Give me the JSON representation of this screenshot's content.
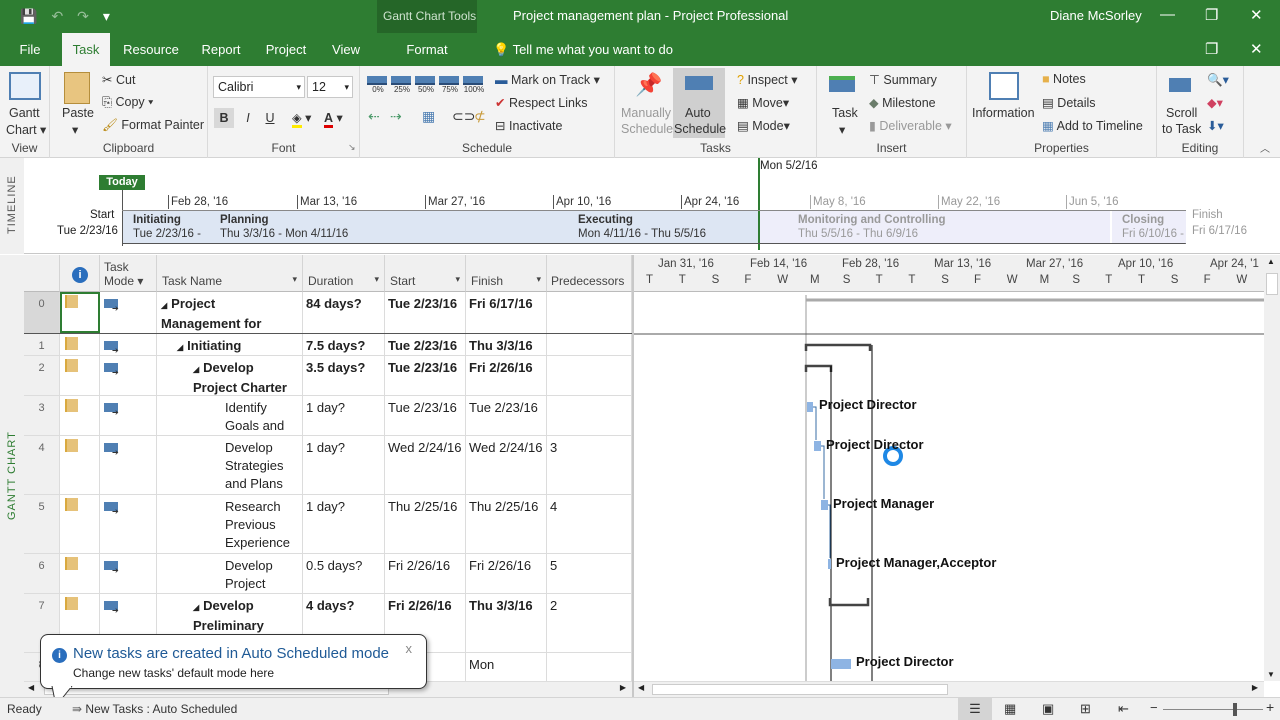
{
  "titlebar": {
    "context_tool": "Gantt Chart Tools",
    "title": "Project management plan - Project Professional",
    "user": "Diane McSorley",
    "icons": [
      "save-icon",
      "undo-icon",
      "redo-icon",
      "customize-qat-icon"
    ],
    "window_controls": [
      "minimize",
      "restore",
      "close"
    ]
  },
  "tabs": [
    {
      "label": "File"
    },
    {
      "label": "Task",
      "active": true
    },
    {
      "label": "Resource"
    },
    {
      "label": "Report"
    },
    {
      "label": "Project"
    },
    {
      "label": "View"
    },
    {
      "label": "Format"
    }
  ],
  "tell_me": "Tell me what you want to do",
  "ribbon": {
    "view": {
      "group": "View",
      "gantt_chart": "Gantt",
      "gantt_chart2": "Chart ▾"
    },
    "clipboard": {
      "group": "Clipboard",
      "paste": "Paste",
      "cut": "Cut",
      "copy": "Copy",
      "format_painter": "Format Painter"
    },
    "font": {
      "group": "Font",
      "family": "Calibri",
      "size": "12",
      "bold": "B",
      "italic": "I",
      "underline": "U"
    },
    "schedule": {
      "group": "Schedule",
      "percents": [
        "0%",
        "25%",
        "50%",
        "75%",
        "100%"
      ],
      "mark_on_track": "Mark on Track",
      "respect_links": "Respect Links",
      "inactivate": "Inactivate"
    },
    "tasks": {
      "group": "Tasks",
      "manually1": "Manually",
      "manually2": "Schedule",
      "auto1": "Auto",
      "auto2": "Schedule",
      "inspect": "Inspect",
      "move": "Move",
      "mode": "Mode"
    },
    "insert": {
      "group": "Insert",
      "task": "Task",
      "summary": "Summary",
      "milestone": "Milestone",
      "deliverable": "Deliverable"
    },
    "properties": {
      "group": "Properties",
      "information": "Information",
      "notes": "Notes",
      "details": "Details",
      "add_to_timeline": "Add to Timeline"
    },
    "editing": {
      "group": "Editing",
      "scroll1": "Scroll",
      "scroll2": "to Task"
    }
  },
  "timeline": {
    "label": "TIMELINE",
    "today": "Today",
    "current_date": "Mon 5/2/16",
    "start_label": "Start",
    "start_date": "Tue 2/23/16",
    "finish_label": "Finish",
    "finish_date": "Fri 6/17/16",
    "ticks": [
      "Feb 28, '16",
      "Mar 13, '16",
      "Mar 27, '16",
      "Apr 10, '16",
      "Apr 24, '16",
      "May 8, '16",
      "May 22, '16",
      "Jun 5, '16"
    ],
    "phases": [
      {
        "name": "Initiating",
        "dates": "Tue 2/23/16 -"
      },
      {
        "name": "Planning",
        "dates": "Thu 3/3/16 - Mon 4/11/16"
      },
      {
        "name": "Executing",
        "dates": "Mon 4/11/16 - Thu 5/5/16"
      },
      {
        "name": "Monitoring and Controlling",
        "dates": "Thu 5/5/16 - Thu 6/9/16"
      },
      {
        "name": "Closing",
        "dates": "Fri 6/10/16 -"
      }
    ]
  },
  "sheet": {
    "side_label": "GANTT CHART",
    "columns": [
      "Task Mode ▾",
      "Task Name",
      "Duration",
      "Start",
      "Finish",
      "Predecessors"
    ],
    "rows": [
      {
        "id": "0",
        "name": "Project Management for",
        "duration": "84 days?",
        "start": "Tue 2/23/16",
        "finish": "Fri 6/17/16",
        "pred": "",
        "bold": true
      },
      {
        "id": "1",
        "name": "Initiating",
        "duration": "7.5 days?",
        "start": "Tue 2/23/16",
        "finish": "Thu 3/3/16",
        "pred": "",
        "bold": true
      },
      {
        "id": "2",
        "name": "Develop Project Charter",
        "duration": "3.5 days?",
        "start": "Tue 2/23/16",
        "finish": "Fri 2/26/16",
        "pred": "",
        "bold": true
      },
      {
        "id": "3",
        "name": "Identify Goals and",
        "duration": "1 day?",
        "start": "Tue 2/23/16",
        "finish": "Tue 2/23/16",
        "pred": ""
      },
      {
        "id": "4",
        "name": "Develop Strategies and Plans",
        "duration": "1 day?",
        "start": "Wed 2/24/16",
        "finish": "Wed 2/24/16",
        "pred": "3"
      },
      {
        "id": "5",
        "name": "Research Previous Experience",
        "duration": "1 day?",
        "start": "Thu 2/25/16",
        "finish": "Thu 2/25/16",
        "pred": "4"
      },
      {
        "id": "6",
        "name": "Develop Project",
        "duration": "0.5 days?",
        "start": "Fri 2/26/16",
        "finish": "Fri 2/26/16",
        "pred": "5"
      },
      {
        "id": "7",
        "name": "Develop Preliminary",
        "duration": "4 days?",
        "start": "Fri 2/26/16",
        "finish": "Thu 3/3/16",
        "pred": "2",
        "bold": true
      },
      {
        "id": "8",
        "name": "",
        "duration": "",
        "start": "…6/16",
        "finish": "Mon",
        "pred": ""
      }
    ]
  },
  "gantt": {
    "months": [
      "Jan 31, '16",
      "Feb 14, '16",
      "Feb 28, '16",
      "Mar 13, '16",
      "Mar 27, '16",
      "Apr 10, '16",
      "Apr 24, '1"
    ],
    "days": [
      "T",
      "T",
      "S",
      "F",
      "W",
      "M",
      "S",
      "T",
      "T",
      "S",
      "F",
      "W",
      "M",
      "S",
      "T",
      "T",
      "S",
      "F",
      "W"
    ],
    "resources": [
      "Project Director",
      "Project Director",
      "Project Manager",
      "Project Manager,Acceptor",
      "Project Director"
    ]
  },
  "callout": {
    "title": "New tasks are created in Auto Scheduled mode",
    "subtitle": "Change new tasks' default mode here",
    "close": "x"
  },
  "status": {
    "ready": "Ready",
    "new_tasks": "New Tasks : Auto Scheduled",
    "zoom_fraction": 0.7
  }
}
